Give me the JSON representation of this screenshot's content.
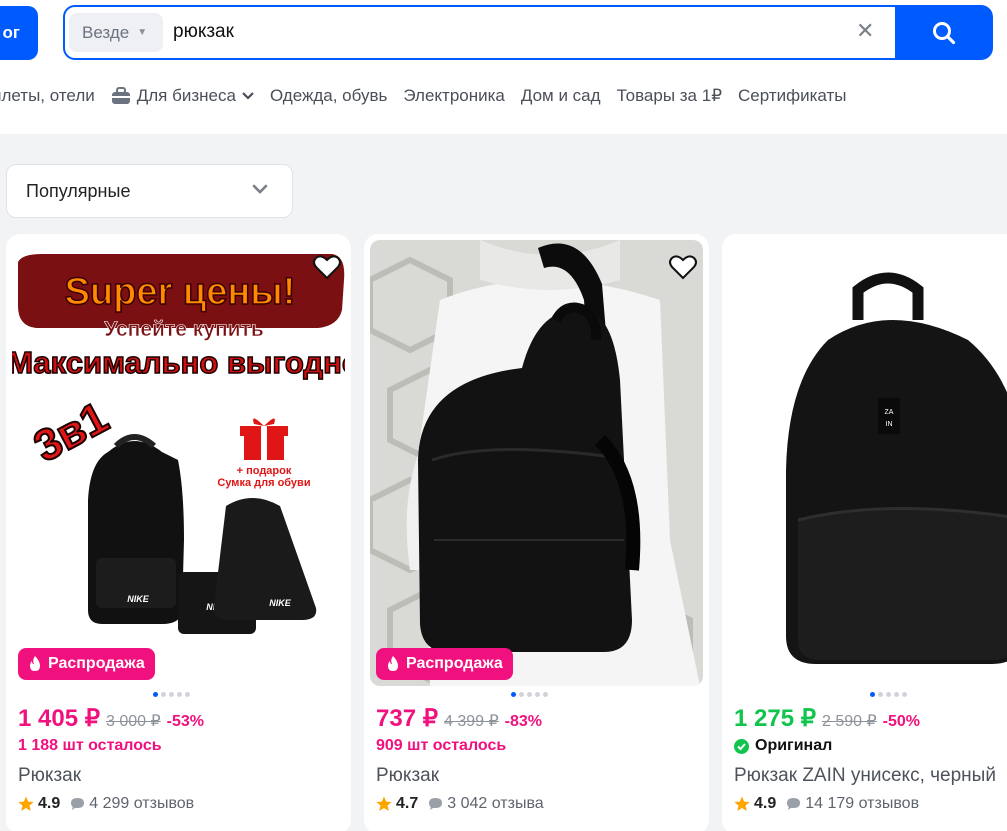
{
  "header": {
    "catalog_label": "ог",
    "search": {
      "scope": "Везде",
      "query": "рюкзак"
    }
  },
  "nav": {
    "items": [
      "илеты, отели",
      "Для бизнеса",
      "Одежда, обувь",
      "Электроника",
      "Дом и сад",
      "Товары за 1₽",
      "Сертификаты"
    ]
  },
  "sort": {
    "selected": "Популярные"
  },
  "products": [
    {
      "badge": "Распродажа",
      "price": "1 405 ₽",
      "old_price": "3 000 ₽",
      "discount": "-53%",
      "stock": "1 188 шт осталось",
      "title": "Рюкзак",
      "rating": "4.9",
      "reviews": "4 299 отзывов",
      "image_lines": [
        "Super цены!",
        "Успейте купить",
        "Максимально выгодно",
        "3в1",
        "+ подарок",
        "Сумка для обуви"
      ]
    },
    {
      "badge": "Распродажа",
      "price": "737 ₽",
      "old_price": "4 399 ₽",
      "discount": "-83%",
      "stock": "909 шт осталось",
      "title": "Рюкзак",
      "rating": "4.7",
      "reviews": "3 042 отзыва"
    },
    {
      "price": "1 275 ₽",
      "old_price": "2 590 ₽",
      "discount": "-50%",
      "original_label": "Оригинал",
      "title": "Рюкзак ZAIN унисекс, черный",
      "rating": "4.9",
      "reviews": "14 179 отзывов",
      "brand_mark": [
        "ZA",
        "IN"
      ]
    }
  ],
  "colors": {
    "accent": "#005bff",
    "sale_pink": "#f1117e",
    "green_price": "#10c44c",
    "star": "#ffa500"
  }
}
